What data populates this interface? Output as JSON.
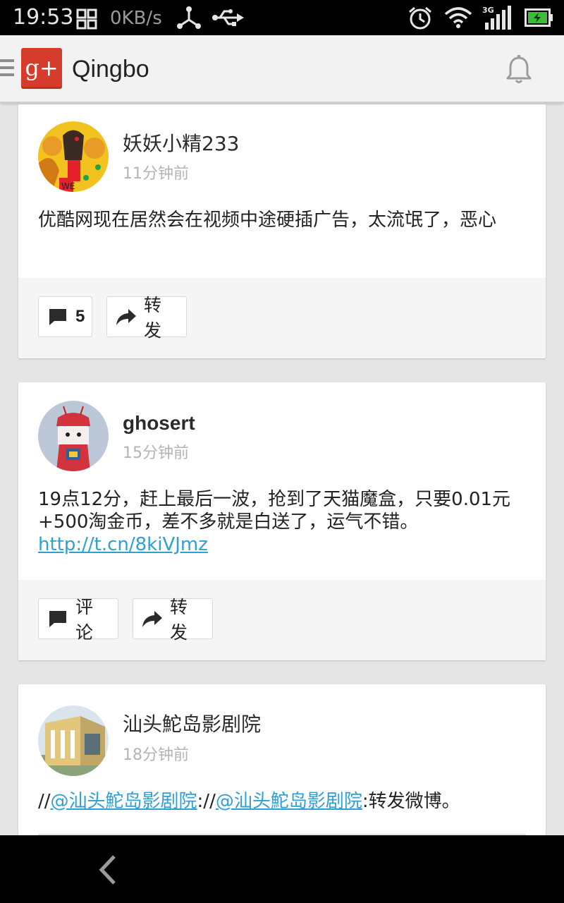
{
  "status_bar": {
    "time": "19:53",
    "net_speed": "0KB/s",
    "network_type": "3G",
    "icons": [
      "grid-icon",
      "share-icon",
      "usb-icon",
      "alarm-icon",
      "wifi-icon",
      "signal-icon",
      "battery-icon"
    ]
  },
  "action_bar": {
    "logo_text": "g+",
    "title": "Qingbo",
    "icons": [
      "menu-icon",
      "bell-icon"
    ]
  },
  "posts": [
    {
      "author": "妖妖小精233",
      "time_ago": "11分钟前",
      "content": "优酷网现在居然会在视频中途硬插广告，太流氓了，恶心",
      "comment_count": "5",
      "repost_label": "转发"
    },
    {
      "author": "ghosert",
      "time_ago": "15分钟前",
      "content": "19点12分，赶上最后一波，抢到了天猫魔盒，只要0.01元+500淘金币，差不多就是白送了，运气不错。",
      "link": "http://t.cn/8kiVJmz",
      "comment_label": "评论",
      "repost_label": "转发"
    },
    {
      "author": "汕头鮀岛影剧院",
      "time_ago": "18分钟前",
      "content_prefix": "//",
      "mention1": "@汕头鮀岛影剧院",
      "content_sep": "://",
      "mention2": "@汕头鮀岛影剧院",
      "content_suffix": ":转发微博。"
    }
  ],
  "colors": {
    "link": "#2f9fd4",
    "gplus_red": "#d63c2b",
    "battery_green": "#3bbd3b"
  }
}
